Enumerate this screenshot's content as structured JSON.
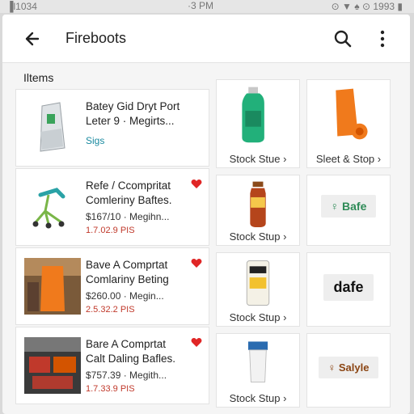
{
  "status": {
    "left": "▐l1034",
    "center": "·3 PM",
    "right": "⊙ ▼ ♠ ⊙ 1993 ▮"
  },
  "app": {
    "title": "Fireboots"
  },
  "section": {
    "label": "Iltems"
  },
  "list": [
    {
      "title1": "Batey Gid Dryt Port",
      "title2": "Leter 9 · Megirts...",
      "price": "",
      "sub": "Sigs",
      "sub_color": "#1a8aa0",
      "heart": false
    },
    {
      "title1": "Refe / Ccompritat",
      "title2": "Comleriny Baftes.",
      "price": "$167/10 · Megihn...",
      "sub": "1.7.02.9 PIS",
      "heart": true
    },
    {
      "title1": "Bave A Comprtat",
      "title2": "Comlariny Beting",
      "price": "$260.00 · Megin...",
      "sub": "2.5.32.2 PIS",
      "heart": true
    },
    {
      "title1": "Bare A Comprtat",
      "title2": "Calt Daling Bafles.",
      "price": "$757.39 · Megith...",
      "sub": "1.7.33.9 PIS",
      "heart": true
    }
  ],
  "grid": [
    [
      {
        "label": "Stock Stue ›"
      },
      {
        "label": "Sleet & Stop ›"
      }
    ],
    [
      {
        "label": "Stock Stup ›"
      },
      {
        "badge": "♀ Bafe",
        "badge_color": "#2e8b57"
      }
    ],
    [
      {
        "label": "Stock Stup ›"
      },
      {
        "badge": "dafe",
        "badge_color": "#111111"
      }
    ],
    [
      {
        "label": "Stock Stup ›"
      },
      {
        "badge": "♀ Salyle",
        "badge_color": "#8b4513"
      }
    ]
  ],
  "icons": [
    "back-arrow-icon",
    "search-icon",
    "more-vert-icon",
    "heart-icon"
  ],
  "colors": {
    "accent_red": "#e02626",
    "teal": "#1a8aa0",
    "orange": "#f07a1c"
  }
}
